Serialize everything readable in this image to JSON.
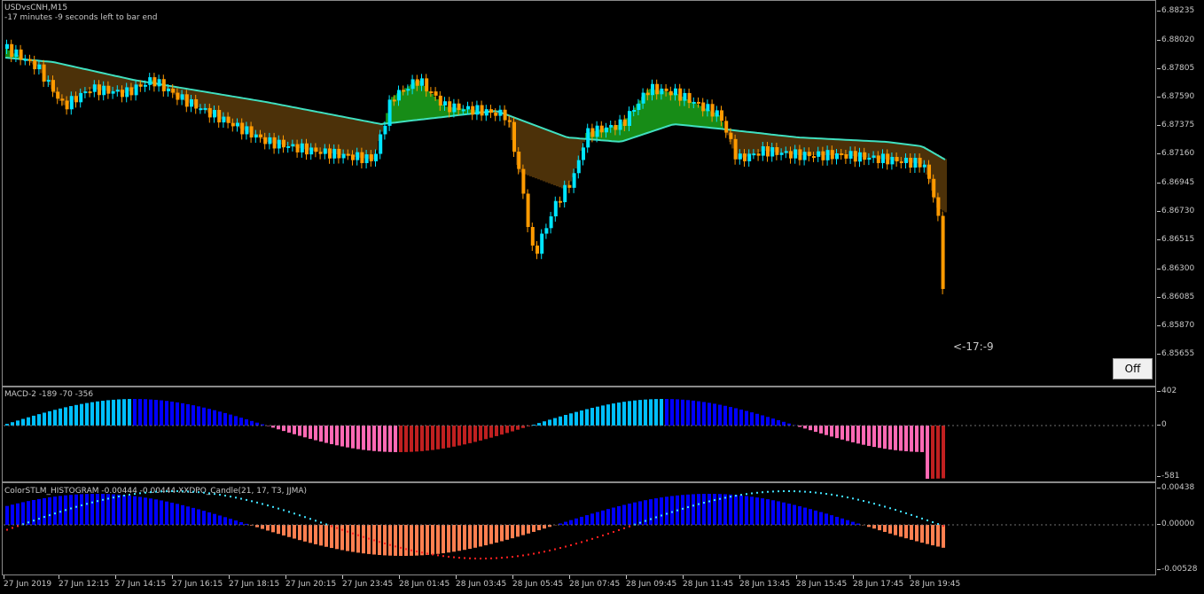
{
  "main": {
    "symbol_label": "USDvsCNH,M15",
    "timer_label": "-17 minutes -9 seconds left to bar end",
    "countdown": "<-17:-9",
    "off_button": "Off",
    "price_ticks": [
      "6.88235",
      "6.88020",
      "6.87805",
      "6.87590",
      "6.87375",
      "6.87160",
      "6.86945",
      "6.86730",
      "6.86515",
      "6.86300",
      "6.86085",
      "6.85870",
      "6.85655"
    ]
  },
  "macd": {
    "label": "MACD-2 -189 -70 -356",
    "ticks": [
      "402",
      "0",
      "-581"
    ]
  },
  "stlm": {
    "label": "ColorSTLM_HISTOGRAM -0.00444 -0.00444 XXDPO_Candle(21, 17, T3, JJMA)",
    "ticks": [
      "0.00438",
      "0.00000",
      "-0.00528"
    ]
  },
  "time_axis": [
    "27 Jun 2019",
    "27 Jun 12:15",
    "27 Jun 14:15",
    "27 Jun 16:15",
    "27 Jun 18:15",
    "27 Jun 20:15",
    "27 Jun 23:45",
    "28 Jun 01:45",
    "28 Jun 03:45",
    "28 Jun 05:45",
    "28 Jun 07:45",
    "28 Jun 09:45",
    "28 Jun 11:45",
    "28 Jun 13:45",
    "28 Jun 15:45",
    "28 Jun 17:45",
    "28 Jun 19:45"
  ],
  "colors": {
    "bull": "#00e5ff",
    "bear": "#ff9a00",
    "ribbon_top": "#40e0c0",
    "bear_fill": "#ff2a00",
    "bull_fill": "#2aff2a",
    "macd_up_strong": "#0000ff",
    "macd_up_weak": "#00bfff",
    "macd_dn_strong": "#c02020",
    "macd_dn_weak": "#ff69b4",
    "stlm_pos": "#0000ff",
    "stlm_neg": "#ff7f50"
  }
}
